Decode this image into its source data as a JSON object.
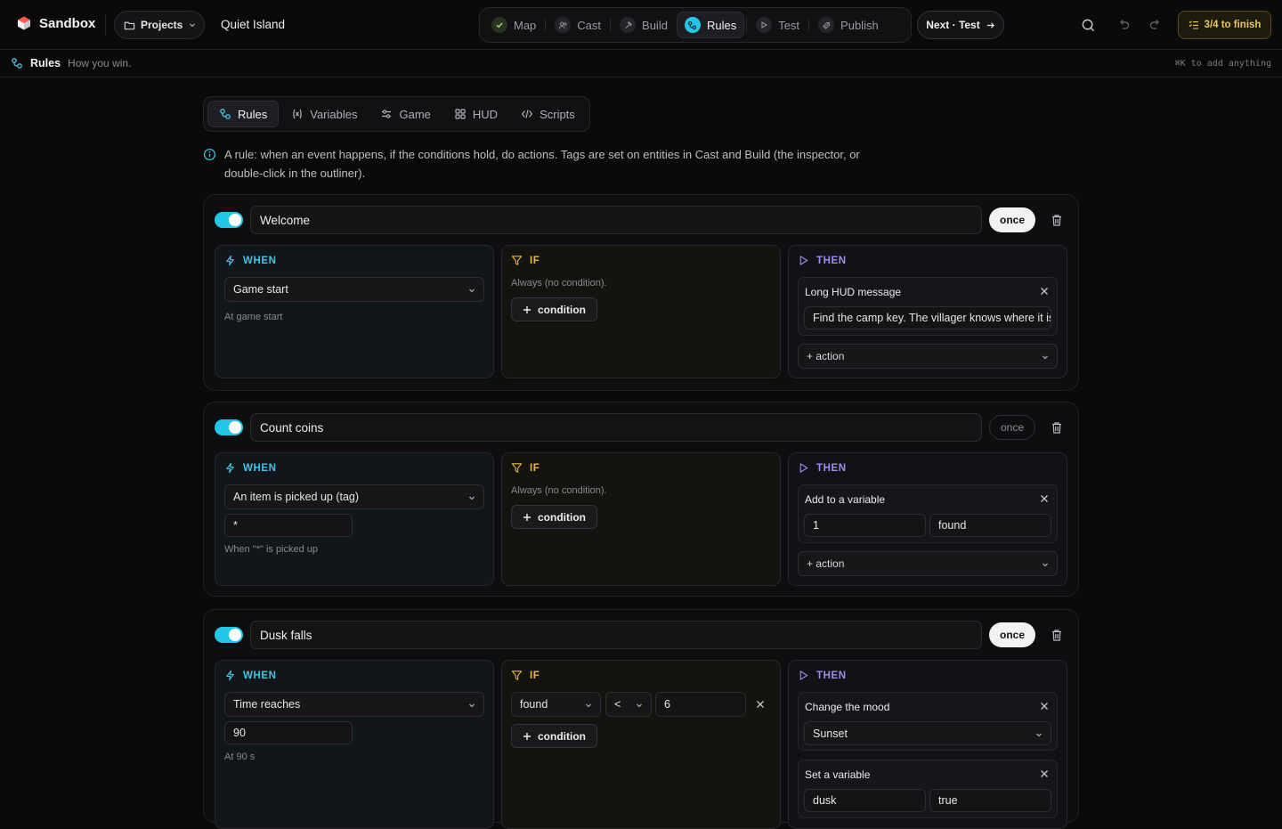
{
  "app": {
    "name": "Sandbox",
    "projects_label": "Projects",
    "project_name": "Quiet Island"
  },
  "steps": [
    {
      "label": "Map",
      "state": "done"
    },
    {
      "label": "Cast",
      "state": "idle"
    },
    {
      "label": "Build",
      "state": "idle"
    },
    {
      "label": "Rules",
      "state": "active"
    },
    {
      "label": "Test",
      "state": "idle"
    },
    {
      "label": "Publish",
      "state": "idle"
    }
  ],
  "next_label": "Next · Test",
  "finish": {
    "label": "3/4 to finish"
  },
  "subbar": {
    "title": "Rules",
    "desc": "How you win.",
    "hint": "⌘K to add anything"
  },
  "tabs": [
    {
      "label": "Rules"
    },
    {
      "label": "Variables"
    },
    {
      "label": "Game"
    },
    {
      "label": "HUD"
    },
    {
      "label": "Scripts"
    }
  ],
  "info_text": "A rule: when an event happens, if the conditions hold, do actions. Tags are set on entities in Cast and Build (the inspector, or double-click in the outliner).",
  "labels": {
    "when": "WHEN",
    "if": "IF",
    "then": "THEN",
    "add_condition": "condition",
    "add_action": "+ action",
    "once": "once"
  },
  "colors": {
    "accent": "#22c7e8",
    "when": "#3fc6e3",
    "if": "#e7b93c",
    "then": "#a18cf0",
    "finish": "#e9c660"
  },
  "rules": [
    {
      "enabled": true,
      "name": "Welcome",
      "once": true,
      "when": {
        "event": "Game start",
        "hint": "At game start"
      },
      "if": {
        "hint": "Always (no condition)."
      },
      "then": [
        {
          "title": "Long HUD message",
          "value": "Find the camp key. The villager knows where it is."
        }
      ]
    },
    {
      "enabled": true,
      "name": "Count coins",
      "once": false,
      "when": {
        "event": "An item is picked up (tag)",
        "param": "*",
        "hint": "When \"*\" is picked up"
      },
      "if": {
        "hint": "Always (no condition)."
      },
      "then": [
        {
          "title": "Add to a variable",
          "amount": "1",
          "variable": "found"
        }
      ]
    },
    {
      "enabled": true,
      "name": "Dusk falls",
      "once": true,
      "when": {
        "event": "Time reaches",
        "param": "90",
        "hint": "At 90 s"
      },
      "if": {
        "condition": {
          "variable": "found",
          "op": "<",
          "value": "6"
        }
      },
      "then": [
        {
          "title": "Change the mood",
          "value": "Sunset"
        },
        {
          "title": "Set a variable",
          "variable": "dusk",
          "value": "true"
        }
      ]
    }
  ]
}
